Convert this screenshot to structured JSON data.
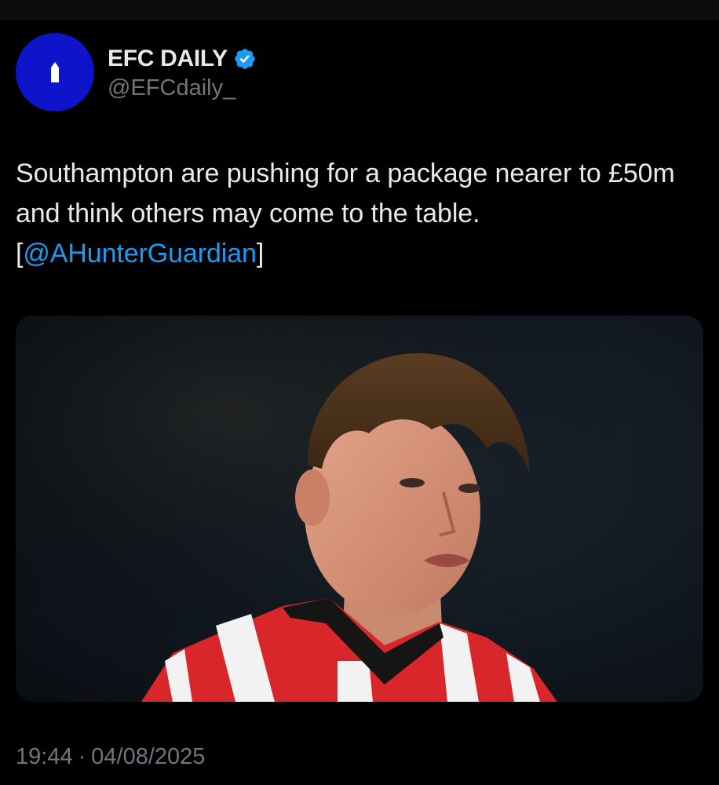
{
  "author": {
    "display_name": "EFC DAILY",
    "handle": "@EFCdaily_",
    "verified": true,
    "avatar_color": "#0d14c9",
    "avatar_icon": "tower-icon"
  },
  "tweet": {
    "text_main": "Southampton are pushing for a package nearer to £50m and think others may come to the table.",
    "bracket_open": "[",
    "mention": "@AHunterGuardian",
    "bracket_close": "]"
  },
  "meta": {
    "time": "19:44",
    "separator": "·",
    "date": "04/08/2025"
  },
  "colors": {
    "background": "#000000",
    "text": "#e7e9ea",
    "secondary_text": "#71767b",
    "link": "#1d9bf0",
    "verified_badge": "#1d9bf0"
  }
}
